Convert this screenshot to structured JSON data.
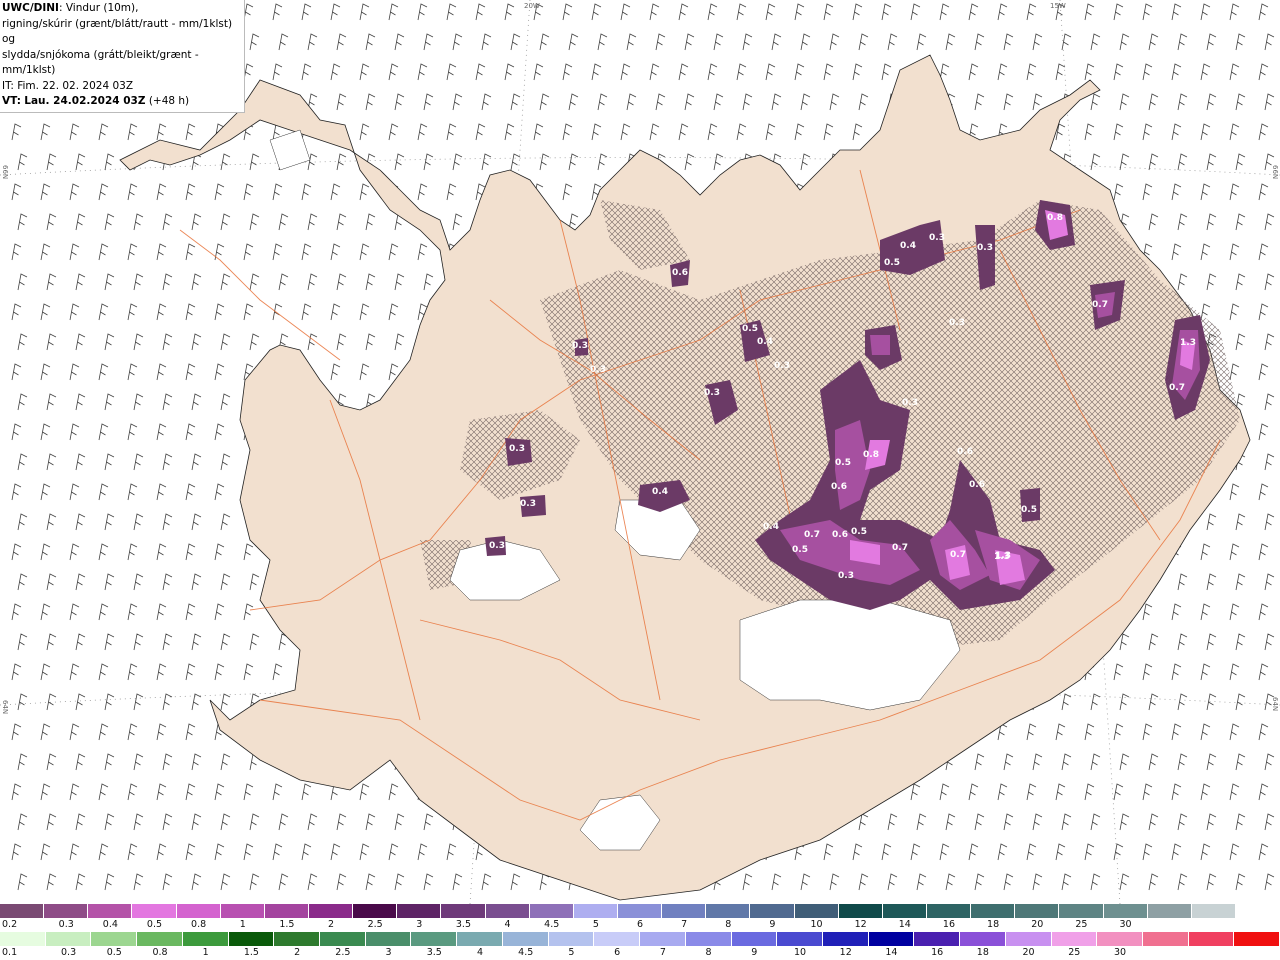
{
  "header": {
    "model": "UWC/DINI",
    "description_line1": ": Vindur (10m),",
    "description_line2": "rigning/skúrir (grænt/blátt/rautt - mm/1klst) og",
    "description_line3": "slydda/snjókoma (grátt/bleikt/grænt - mm/1klst)",
    "issue_time": "IT: Fim. 22. 02. 2024 03Z",
    "valid_label": "VT:",
    "valid_time": "Lau. 24.02.2024 03Z",
    "lead_time": "(+48 h)"
  },
  "grid_labels": {
    "lon_20w": "20W",
    "lon_15w": "15W",
    "lat_66n_left": "66N",
    "lat_66n_right": "66N",
    "lat_64n_left": "64N",
    "lat_64n_right": "64N"
  },
  "precip_labels": [
    "0.6",
    "0.8",
    "0.4",
    "0.3",
    "0.5",
    "0.3",
    "0.7",
    "1.3",
    "0.7",
    "1.3",
    "0.3",
    "0.5",
    "0.4",
    "0.3",
    "0.3",
    "0.3",
    "0.3",
    "0.3",
    "0.3",
    "0.3",
    "0.3",
    "0.4",
    "0.5",
    "0.8",
    "0.6",
    "0.6",
    "0.4",
    "0.5",
    "0.6",
    "0.5",
    "0.7",
    "0.3",
    "0.7",
    "1.3",
    "0.6",
    "0.5",
    "0.7"
  ],
  "legend": {
    "snow_scale": {
      "colors": [
        "#7a4a73",
        "#8e4c87",
        "#b453a8",
        "#e377e0",
        "#d463cf",
        "#b850b1",
        "#a4449f",
        "#8a2a8a",
        "#4a0a4a",
        "#5e2466",
        "#6e3a7a",
        "#7a4e90",
        "#8e70b8",
        "#aeaef0",
        "#8a90d8",
        "#7080c0",
        "#6078a8",
        "#506a90",
        "#405e78",
        "#104a4a",
        "#1e5858",
        "#2e6464",
        "#3e6e6e",
        "#4e7878",
        "#5e8484",
        "#6e9090",
        "#8ea0a4",
        "#c8d2d4",
        "#ffffff"
      ],
      "ticks": [
        "0.2",
        "0.3",
        "0.4",
        "0.5",
        "0.8",
        "1",
        "1.5",
        "2",
        "2.5",
        "3",
        "3.5",
        "4",
        "4.5",
        "5",
        "6",
        "7",
        "8",
        "9",
        "10",
        "12",
        "14",
        "16",
        "18",
        "20",
        "25",
        "30"
      ]
    },
    "rain_scale": {
      "colors": [
        "#e6fce0",
        "#c8eec0",
        "#9cd690",
        "#6ab860",
        "#3c9a3c",
        "#0a5a0a",
        "#2e7a2e",
        "#3a8a50",
        "#4a8e6a",
        "#5a9a80",
        "#7aaab0",
        "#98b4d8",
        "#b4c2ee",
        "#c8ccf8",
        "#a8aaf0",
        "#8a8ae8",
        "#6a6ae0",
        "#4a4ad0",
        "#2020b8",
        "#0000a0",
        "#4a20b0",
        "#8a50d8",
        "#c890f0",
        "#f0a0e8",
        "#f290c0",
        "#f07090",
        "#f04060",
        "#f01010"
      ],
      "ticks": [
        "0.1",
        "0.3",
        "0.5",
        "0.8",
        "1",
        "1.5",
        "2",
        "2.5",
        "3",
        "3.5",
        "4",
        "4.5",
        "5",
        "6",
        "7",
        "8",
        "9",
        "10",
        "12",
        "14",
        "16",
        "18",
        "20",
        "25",
        "30"
      ]
    }
  }
}
